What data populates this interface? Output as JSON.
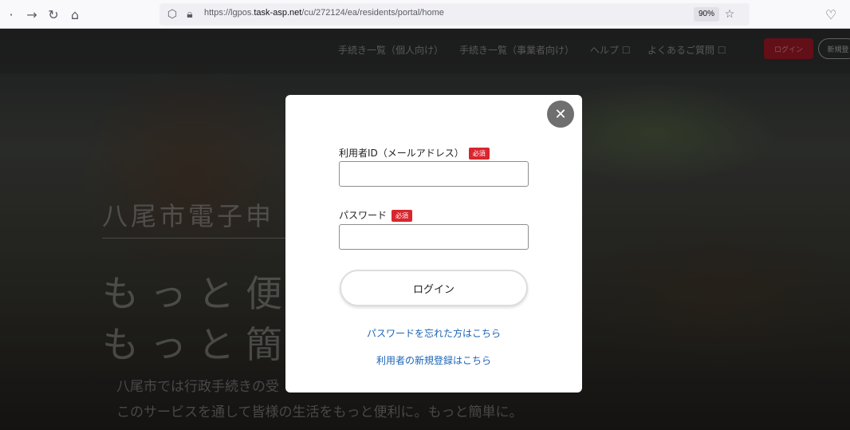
{
  "browser": {
    "url_prefix": "https://lgpos.",
    "url_domain": "task-asp.net",
    "url_path": "/cu/272124/ea/residents/portal/home",
    "zoom": "90%",
    "icons": {
      "back": "arrow-left",
      "forward": "arrow-right",
      "reload": "reload",
      "home": "home",
      "shield": "shield",
      "lock": "lock",
      "star": "star",
      "pocket": "pocket"
    }
  },
  "header": {
    "nav": [
      {
        "label": "手続き一覧（個人向け）"
      },
      {
        "label": "手続き一覧（事業者向け）"
      },
      {
        "label": "ヘルプ ☐"
      },
      {
        "label": "よくあるご質問 ☐"
      }
    ],
    "login_label": "ログイン",
    "register_label": "新規登"
  },
  "hero": {
    "title": "八尾市電子申",
    "line1": "もっと便",
    "line2": "もっと簡",
    "desc1": "八尾市では行政手続きの受",
    "desc2": "このサービスを通して皆様の生活をもっと便利に。もっと簡単に。"
  },
  "modal": {
    "user_id_label": "利用者ID（メールアドレス）",
    "required_badge": "必須",
    "password_label": "パスワード",
    "user_id_value": "",
    "password_value": "",
    "submit_label": "ログイン",
    "forgot_link": "パスワードを忘れた方はこちら",
    "register_link": "利用者の新規登録はこちら"
  },
  "colors": {
    "required": "#d8262f",
    "link": "#1a63b5",
    "header_login": "#8a1520"
  }
}
